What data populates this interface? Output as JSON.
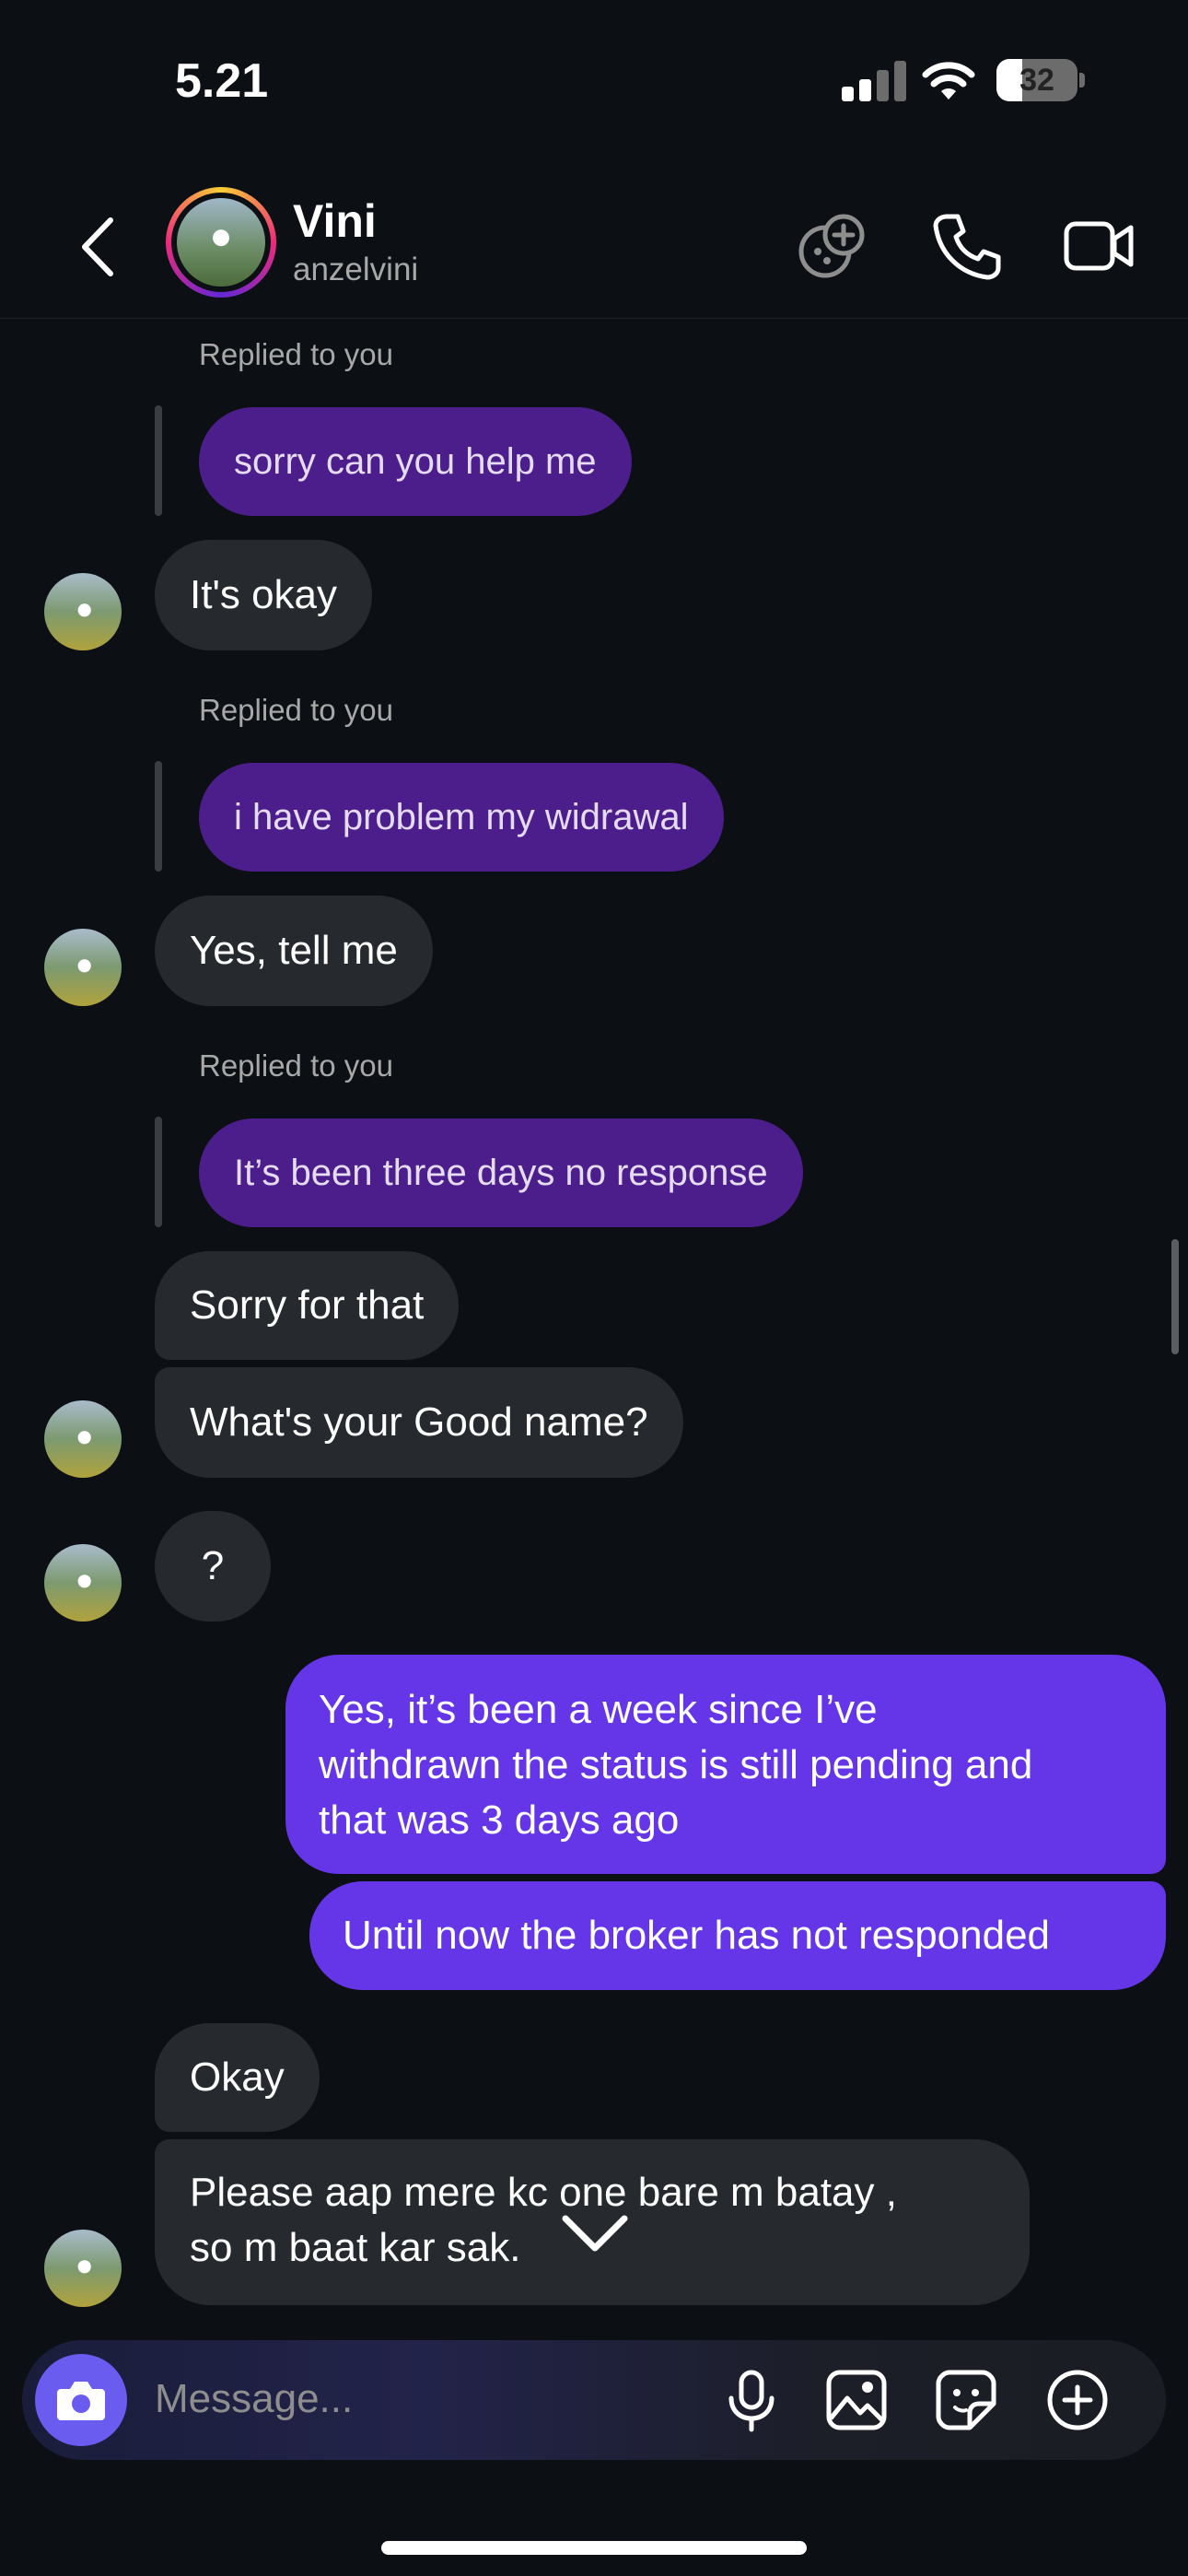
{
  "status_bar": {
    "time": "5.21",
    "battery": "32",
    "battery_level": 0.32
  },
  "header": {
    "name": "Vini",
    "username": "anzelvini"
  },
  "messages": {
    "reply_label": "Replied to you",
    "q1": "sorry can you help me",
    "a1": "It's okay",
    "q2": "i have problem my widrawal",
    "a2": "Yes, tell me",
    "q3": "It’s been three days no response",
    "a3": "Sorry for that",
    "a4": "What's your Good name?",
    "a5": "?",
    "out1_line1": "Yes, it’s been a week since I’ve",
    "out1_line2": "withdrawn the status is still pending and",
    "out1_line3": "that was 3 days ago",
    "out2": "Until now the broker has not responded",
    "a6": "Okay",
    "a7_line1": "Please aap mere kc   one bare m batay ,",
    "a7_line2": "so m baat kar sak."
  },
  "composer": {
    "placeholder": "Message..."
  },
  "icons": {
    "back": "chevron-left-icon",
    "games": "game-controller-icon",
    "call": "phone-icon",
    "video": "video-camera-icon",
    "camera": "camera-icon",
    "mic": "microphone-icon",
    "gallery": "image-icon",
    "sticker": "sticker-icon",
    "add": "plus-circle-icon",
    "scroll_down": "chevron-down-icon"
  },
  "colors": {
    "background": "#0c1014",
    "incoming_bubble": "#262a2f",
    "outgoing_bubble": "#6536e8",
    "quoted_bubble": "#4c1e8c",
    "accent": "#6b5cf0"
  }
}
